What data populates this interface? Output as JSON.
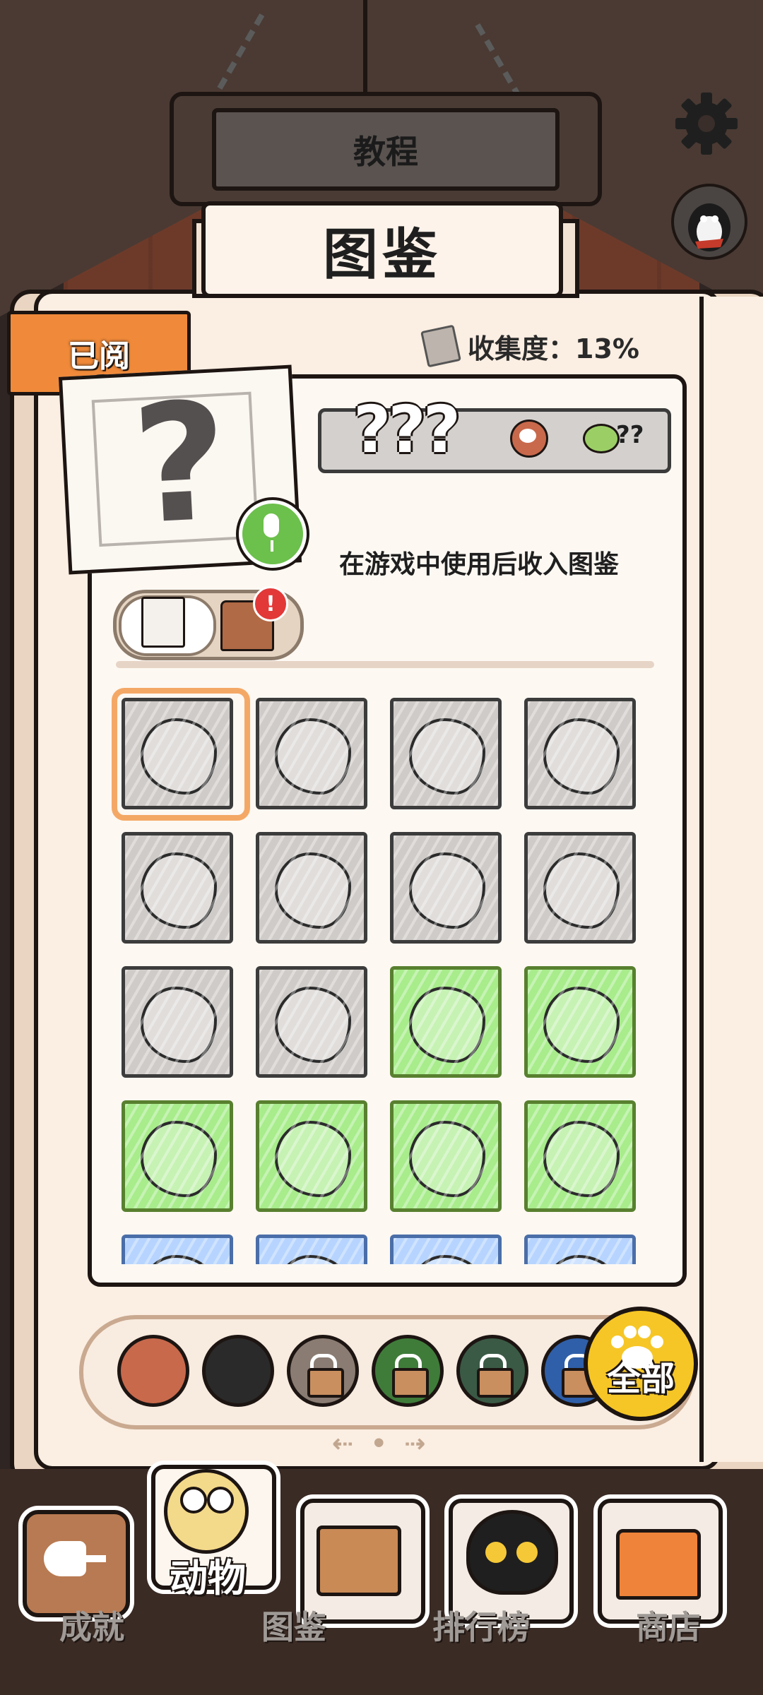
{
  "header": {
    "tutorial_label": "教程",
    "title": "图鉴"
  },
  "book": {
    "read_tab_label": "已阅",
    "collection_label": "收集度：13%",
    "item": {
      "name": "???",
      "cost": "??",
      "description": "在游戏中使用后收入图鉴"
    },
    "badge_count": "!"
  },
  "grid": {
    "selected_index": 0,
    "rows": [
      [
        "gray",
        "gray",
        "gray",
        "gray"
      ],
      [
        "gray",
        "gray",
        "gray",
        "gray"
      ],
      [
        "gray",
        "gray",
        "green",
        "green"
      ],
      [
        "green",
        "green",
        "green",
        "green"
      ],
      [
        "blue",
        "blue",
        "blue",
        "blue"
      ]
    ]
  },
  "categories": [
    {
      "name": "bird-category",
      "locked": false,
      "color": "#c8694c"
    },
    {
      "name": "black-cat-category",
      "locked": false,
      "color": "#2a2a2a"
    },
    {
      "name": "locked-category-1",
      "locked": true,
      "color": "#8a7c72"
    },
    {
      "name": "locked-category-2",
      "locked": true,
      "color": "#3f7c3a"
    },
    {
      "name": "locked-category-3",
      "locked": true,
      "color": "#3a5a45"
    },
    {
      "name": "locked-category-4",
      "locked": true,
      "color": "#2f5fa8"
    }
  ],
  "all_button_label": "全部",
  "pager": "⇠ • ⇢",
  "nav": {
    "items": [
      {
        "label": "成就",
        "active": false
      },
      {
        "label": "动物",
        "active": true
      },
      {
        "label": "图鉴",
        "active": false
      },
      {
        "label": "排行榜",
        "active": false
      },
      {
        "label": "商店",
        "active": false
      }
    ]
  }
}
